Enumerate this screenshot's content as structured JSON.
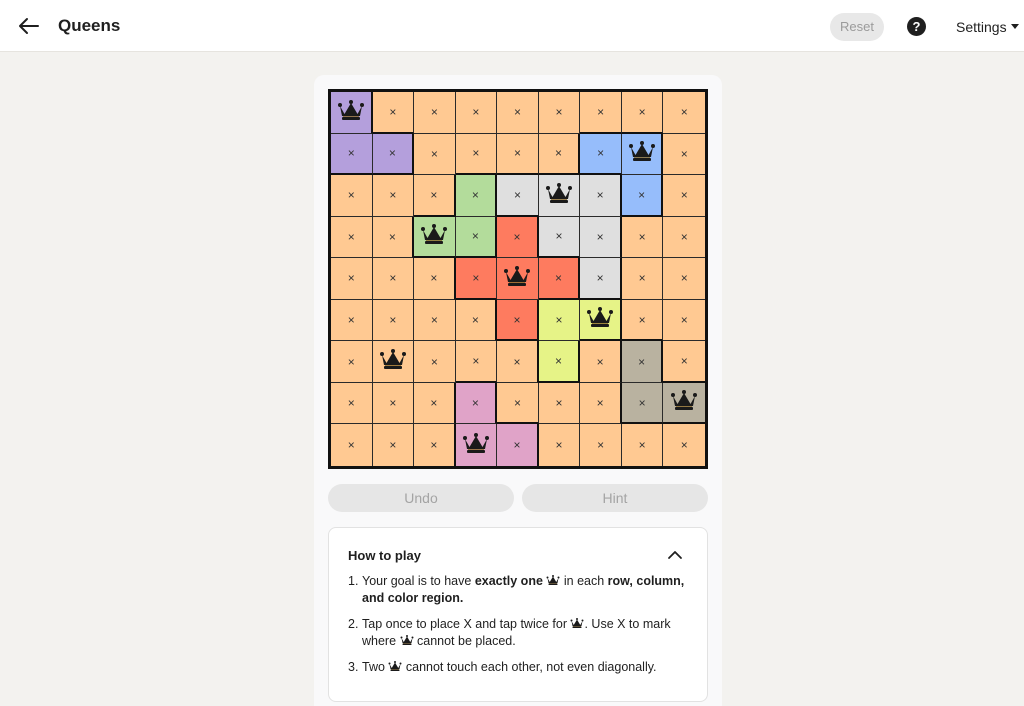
{
  "header": {
    "title": "Queens",
    "reset_label": "Reset",
    "help_label": "?",
    "settings_label": "Settings"
  },
  "palette": {
    "orange": "#ffc992",
    "purple": "#b49fdc",
    "blue": "#96bdfb",
    "green": "#b3dc9b",
    "gray": "#dfdfdf",
    "red": "#fe7b5f",
    "yellow": "#e6f387",
    "taupe": "#b9b2a0",
    "pink": "#e0a3c8"
  },
  "board": {
    "size": 9,
    "empty_mark": "×",
    "regions": [
      [
        "purple",
        "orange",
        "orange",
        "orange",
        "orange",
        "orange",
        "orange",
        "orange",
        "orange"
      ],
      [
        "purple",
        "purple",
        "orange",
        "orange",
        "orange",
        "orange",
        "blue",
        "blue",
        "orange"
      ],
      [
        "orange",
        "orange",
        "orange",
        "green",
        "gray",
        "gray",
        "gray",
        "blue",
        "orange"
      ],
      [
        "orange",
        "orange",
        "green",
        "green",
        "red",
        "gray",
        "gray",
        "orange",
        "orange"
      ],
      [
        "orange",
        "orange",
        "orange",
        "red",
        "red",
        "red",
        "gray",
        "orange",
        "orange"
      ],
      [
        "orange",
        "orange",
        "orange",
        "orange",
        "red",
        "yellow",
        "yellow",
        "orange",
        "orange"
      ],
      [
        "orange",
        "orange",
        "orange",
        "orange",
        "orange",
        "yellow",
        "orange",
        "taupe",
        "orange"
      ],
      [
        "orange",
        "orange",
        "orange",
        "pink",
        "orange",
        "orange",
        "orange",
        "taupe",
        "taupe"
      ],
      [
        "orange",
        "orange",
        "orange",
        "pink",
        "pink",
        "orange",
        "orange",
        "orange",
        "orange"
      ]
    ],
    "marks": [
      [
        "Q",
        "X",
        "X",
        "X",
        "X",
        "X",
        "X",
        "X",
        "X"
      ],
      [
        "X",
        "X",
        "X",
        "X",
        "X",
        "X",
        "X",
        "Q",
        "X"
      ],
      [
        "X",
        "X",
        "X",
        "X",
        "X",
        "Q",
        "X",
        "X",
        "X"
      ],
      [
        "X",
        "X",
        "Q",
        "X",
        "X",
        "X",
        "X",
        "X",
        "X"
      ],
      [
        "X",
        "X",
        "X",
        "X",
        "Q",
        "X",
        "X",
        "X",
        "X"
      ],
      [
        "X",
        "X",
        "X",
        "X",
        "X",
        "X",
        "Q",
        "X",
        "X"
      ],
      [
        "X",
        "Q",
        "X",
        "X",
        "X",
        "X",
        "X",
        "X",
        "X"
      ],
      [
        "X",
        "X",
        "X",
        "X",
        "X",
        "X",
        "X",
        "X",
        "Q"
      ],
      [
        "X",
        "X",
        "X",
        "Q",
        "X",
        "X",
        "X",
        "X",
        "X"
      ]
    ]
  },
  "controls": {
    "undo_label": "Undo",
    "hint_label": "Hint"
  },
  "how_to_play": {
    "title": "How to play",
    "rules": [
      {
        "num": "1.",
        "a": "Your goal is to have ",
        "b": "exactly one",
        "c": " in each ",
        "d": "row, column, and color region."
      },
      {
        "num": "2.",
        "a": "Tap once to place X and tap twice for ",
        "c": ". Use X to mark where ",
        "e": " cannot be placed."
      },
      {
        "num": "3.",
        "a": "Two ",
        "c": " cannot touch each other, not even diagonally."
      }
    ]
  }
}
